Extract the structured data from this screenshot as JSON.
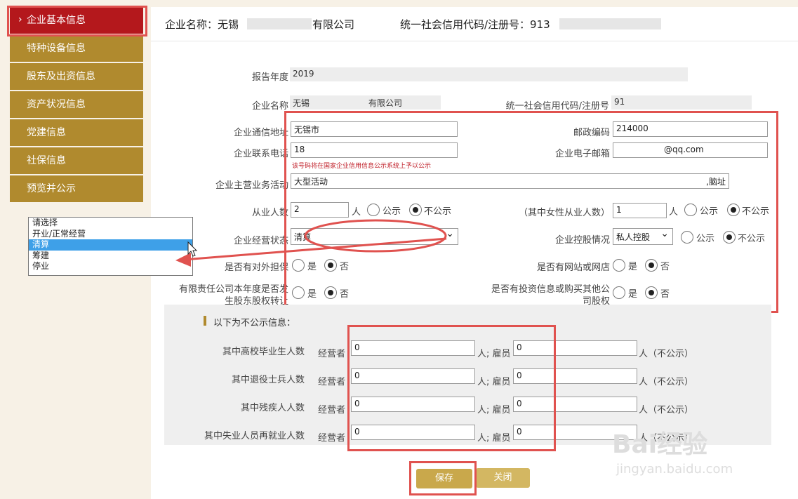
{
  "sidebar": {
    "items": [
      {
        "label": "企业基本信息",
        "active": true
      },
      {
        "label": "特种设备信息"
      },
      {
        "label": "股东及出资信息"
      },
      {
        "label": "资产状况信息"
      },
      {
        "label": "党建信息"
      },
      {
        "label": "社保信息"
      },
      {
        "label": "预览并公示"
      }
    ]
  },
  "header": {
    "company_prefix": "企业名称：无锡",
    "company_suffix": "有限公司",
    "credit_label": "统一社会信用代码/注册号：913"
  },
  "form": {
    "report_year_label": "报告年度",
    "report_year": "2019",
    "company_name_label": "企业名称",
    "company_name_prefix": "无锡",
    "company_name_suffix": "有限公司",
    "credit_code_label": "统一社会信用代码/注册号",
    "credit_code": "91",
    "address_label": "企业通信地址",
    "address_value": "无锡市",
    "postcode_label": "邮政编码",
    "postcode_value": "214000",
    "phone_label": "企业联系电话",
    "phone_value": "18",
    "phone_note": "该号码将在国家企业信用信息公示系统上予以公示",
    "email_label": "企业电子邮箱",
    "email_value": "@qq.com",
    "business_label": "企业主营业务活动",
    "business_value": "大型活动",
    "business_tail": ",脑址",
    "employees_label": "从业人数",
    "employees_value": "2",
    "unit_person": "人",
    "public_label": "公示",
    "nonpublic_label": "不公示",
    "female_label": "（其中女性从业人数）",
    "female_value": "1",
    "status_label": "企业经营状态",
    "status_value": "清算",
    "holding_label": "企业控股情况",
    "holding_value": "私人控股",
    "guarantee_label": "是否有对外担保",
    "website_label": "是否有网站或网店",
    "transfer_label_1": "有限责任公司本年度是否发",
    "transfer_label_2": "生股东股权转让",
    "invest_label_1": "是否有投资信息或购买其他公",
    "invest_label_2": "司股权",
    "yes_label": "是",
    "no_label": "否"
  },
  "nonpublic": {
    "title": "以下为不公示信息：",
    "operator_label": "经营者",
    "employee_label": "人; 雇员",
    "unit_suffix": "人（不公示）",
    "rows": [
      {
        "label": "其中高校毕业生人数",
        "operator": "0",
        "employee": "0"
      },
      {
        "label": "其中退役士兵人数",
        "operator": "0",
        "employee": "0"
      },
      {
        "label": "其中残疾人人数",
        "operator": "0",
        "employee": "0"
      },
      {
        "label": "其中失业人员再就业人数",
        "operator": "0",
        "employee": "0"
      }
    ]
  },
  "buttons": {
    "save": "保存",
    "close": "关闭"
  },
  "dropdown": {
    "options": [
      "请选择",
      "开业/正常经营",
      "清算",
      "筹建",
      "停业"
    ],
    "selected_index": 2
  },
  "watermark": {
    "brand": "Bai经验",
    "url": "jingyan.baidu.com"
  },
  "colors": {
    "sidebar": "#b08a2e",
    "active": "#b4181c",
    "highlight": "#e0524f",
    "button": "#c9a84b"
  }
}
